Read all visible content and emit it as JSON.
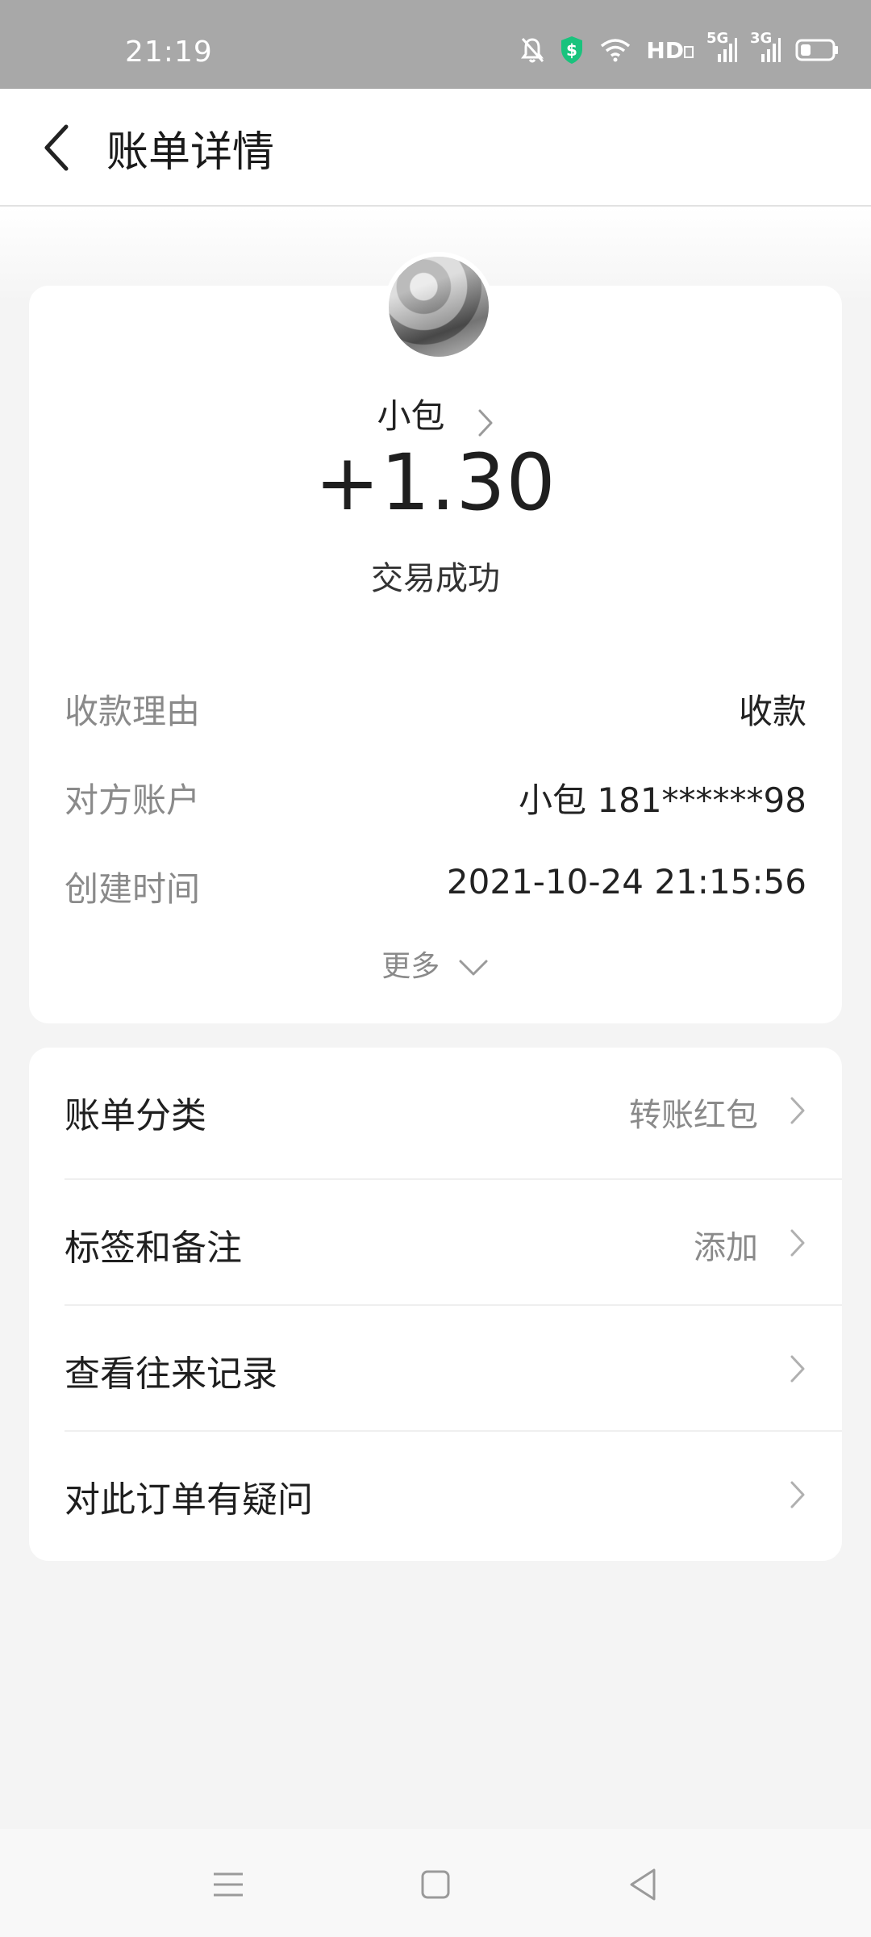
{
  "status_bar": {
    "time": "21:19",
    "network_hd": "HD",
    "network_5g": "5G",
    "network_3g": "3G",
    "icons": [
      "bell-off-icon",
      "shield-dollar-icon",
      "wifi-icon",
      "signal-icon",
      "battery-icon"
    ]
  },
  "header": {
    "title": "账单详情",
    "back_icon": "chevron-left-icon"
  },
  "summary": {
    "payee_name": "小包",
    "amount": "+1.30",
    "status": "交易成功"
  },
  "details": [
    {
      "label": "收款理由",
      "value": "收款"
    },
    {
      "label": "对方账户",
      "value": "小包 181******98"
    },
    {
      "label": "创建时间",
      "value": "2021-10-24 21:15:56"
    }
  ],
  "more_label": "更多",
  "options": [
    {
      "label": "账单分类",
      "value": "转账红包"
    },
    {
      "label": "标签和备注",
      "value": "添加"
    },
    {
      "label": "查看往来记录",
      "value": ""
    },
    {
      "label": "对此订单有疑问",
      "value": ""
    }
  ],
  "colors": {
    "status_bar_bg": "#a8a8a8",
    "page_bg": "#f4f4f4",
    "card_bg": "#ffffff",
    "muted_text": "#8a8a8a",
    "shield_green": "#19c37d"
  }
}
